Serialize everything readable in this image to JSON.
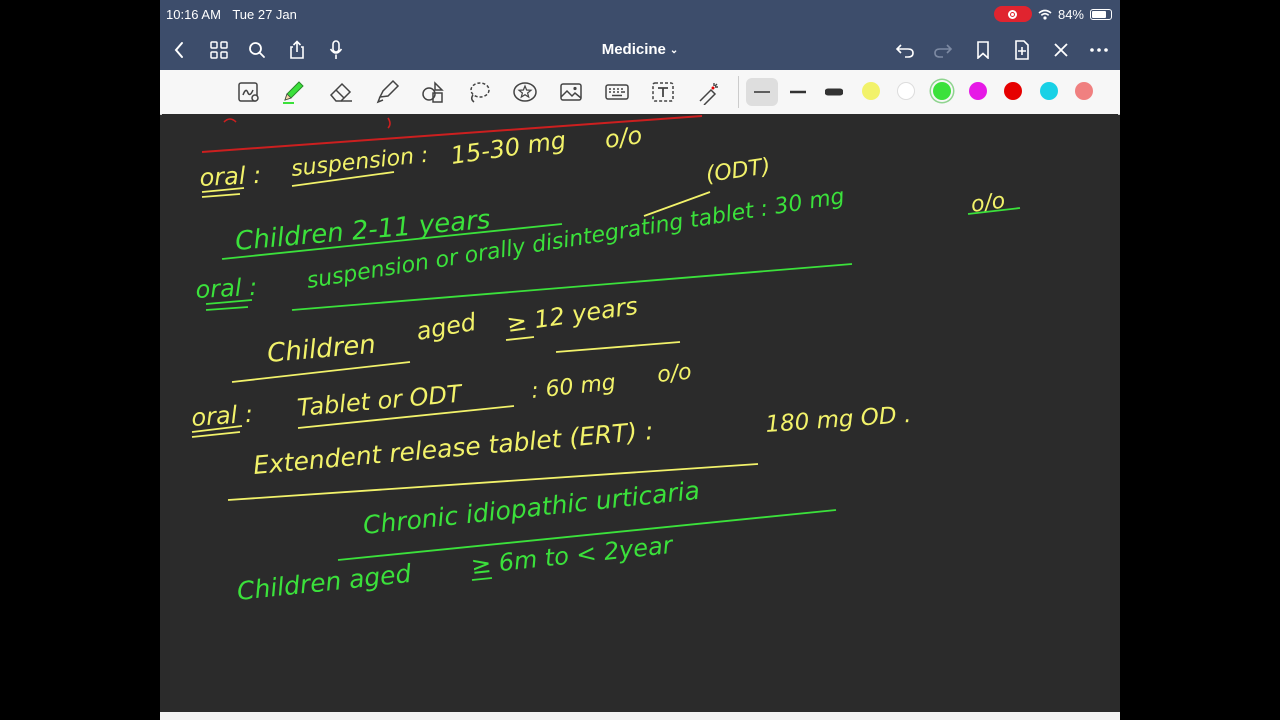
{
  "status": {
    "time": "10:16 AM",
    "date": "Tue 27 Jan",
    "battery": "84%"
  },
  "navbar": {
    "title": "Medicine"
  },
  "icons": {
    "back": "chevron-left-icon",
    "grid": "grid-icon",
    "search": "search-icon",
    "share": "share-icon",
    "mic": "microphone-icon",
    "undo": "undo-icon",
    "redo": "redo-icon",
    "bookmark": "bookmark-icon",
    "add_page": "add-page-icon",
    "close": "close-icon",
    "more": "more-icon"
  },
  "toolbar": {
    "tools": [
      "read-only-icon",
      "pen-icon",
      "eraser-icon",
      "highlighter-icon",
      "shapes-icon",
      "lasso-icon",
      "elements-icon",
      "image-icon",
      "keyboard-icon",
      "text-icon",
      "laser-icon"
    ],
    "stroke_widths": [
      "thin",
      "medium",
      "thick"
    ],
    "colors": [
      "#f2f26a",
      "#ffffff",
      "#3be13b",
      "#e619e6",
      "#e60000",
      "#19d1e6",
      "#f08080"
    ],
    "selected_color": "#3be13b"
  },
  "notes": {
    "line1": "oral : suspension : 15-30 mg o/o",
    "line1_a": "oral :",
    "line1_b": "suspension :",
    "line1_c": "15-30 mg",
    "line1_d": "o/o",
    "odt_bubble": "(ODT)",
    "line2": "Children 2-11 years",
    "line3_a": "oral :",
    "line3_b": "suspension or orally disintegrating tablet : 30 mg",
    "line3_c": "o/o",
    "line4_a": "Children",
    "line4_b": "aged",
    "line4_c": "≥ 12 years",
    "line5_a": "oral :",
    "line5_b": "Tablet or ODT",
    "line5_c": ": 60 mg",
    "line5_d": "o/o",
    "line6_a": "Extendent release tablet (ERT) :",
    "line6_b": "180 mg OD .",
    "line7": "Chronic idiopathic urticaria",
    "line8_a": "Children aged",
    "line8_b": "≥ 6m to < 2year"
  }
}
